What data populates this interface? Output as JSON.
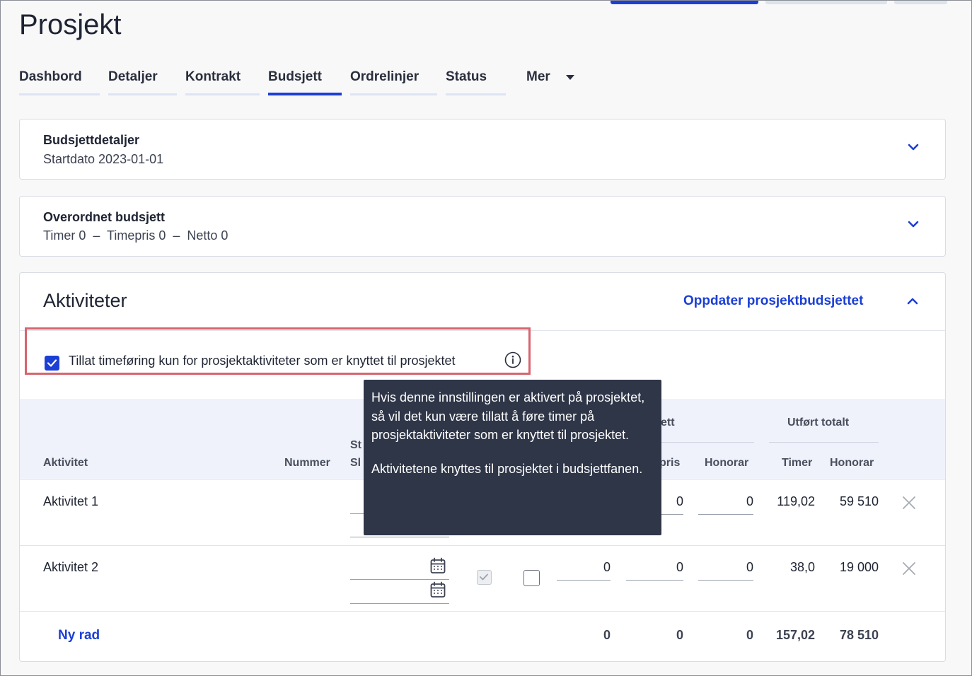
{
  "page": {
    "title": "Prosjekt"
  },
  "tabs": [
    {
      "label": "Dashbord",
      "active": false
    },
    {
      "label": "Detaljer",
      "active": false
    },
    {
      "label": "Kontrakt",
      "active": false
    },
    {
      "label": "Budsjett",
      "active": true
    },
    {
      "label": "Ordrelinjer",
      "active": false
    },
    {
      "label": "Status",
      "active": false
    }
  ],
  "more_tab": {
    "label": "Mer"
  },
  "budget_details": {
    "title": "Budsjettdetaljer",
    "subtitle": "Startdato 2023-01-01"
  },
  "overall_budget": {
    "title": "Overordnet budsjett",
    "subtitle": "Timer 0  –  Timepris 0  –  Netto 0"
  },
  "activities": {
    "title": "Aktiviteter",
    "update_link": "Oppdater prosjektbudsjettet",
    "restrict_checkbox": {
      "label": "Tillat timeføring kun for prosjektaktiviteter som er knyttet til prosjektet",
      "checked": true
    },
    "headers": {
      "activity": "Aktivitet",
      "number": "Nummer",
      "start_partial": "St",
      "end_partial": "Sl",
      "budget_group_partial": "ett",
      "rate_partial": "pris",
      "fee": "Honorar",
      "done_total": "Utført totalt",
      "hours": "Timer",
      "done_fee": "Honorar"
    },
    "rows": [
      {
        "name": "Aktivitet 1",
        "rate": "0",
        "fee": "0",
        "done_hours": "119,02",
        "done_fee": "59 510"
      },
      {
        "name": "Aktivitet 2",
        "hours": "0",
        "rate": "0",
        "fee": "0",
        "done_hours": "38,0",
        "done_fee": "19 000",
        "check_a": true,
        "check_b": false
      }
    ],
    "new_row": "Ny rad",
    "totals": {
      "hours": "0",
      "rate": "0",
      "fee": "0",
      "done_hours": "157,02",
      "done_fee": "78 510"
    }
  },
  "tooltip": {
    "paragraph1": "Hvis denne innstillingen er aktivert på prosjektet, så vil det kun være tillatt å føre timer på prosjektaktiviteter som er knyttet til prosjektet.",
    "paragraph2": "Aktivitetene knyttes til prosjektet i budsjettfanen."
  },
  "colors": {
    "accent": "#1b3fd6",
    "highlight_border": "#d6656e",
    "tooltip_bg": "#2f3648",
    "table_header_bg": "#eff2fa"
  },
  "icons": [
    "chevron-down-icon",
    "chevron-up-icon",
    "info-icon",
    "checkmark-icon",
    "calendar-icon",
    "close-icon",
    "dropdown-caret-icon"
  ]
}
